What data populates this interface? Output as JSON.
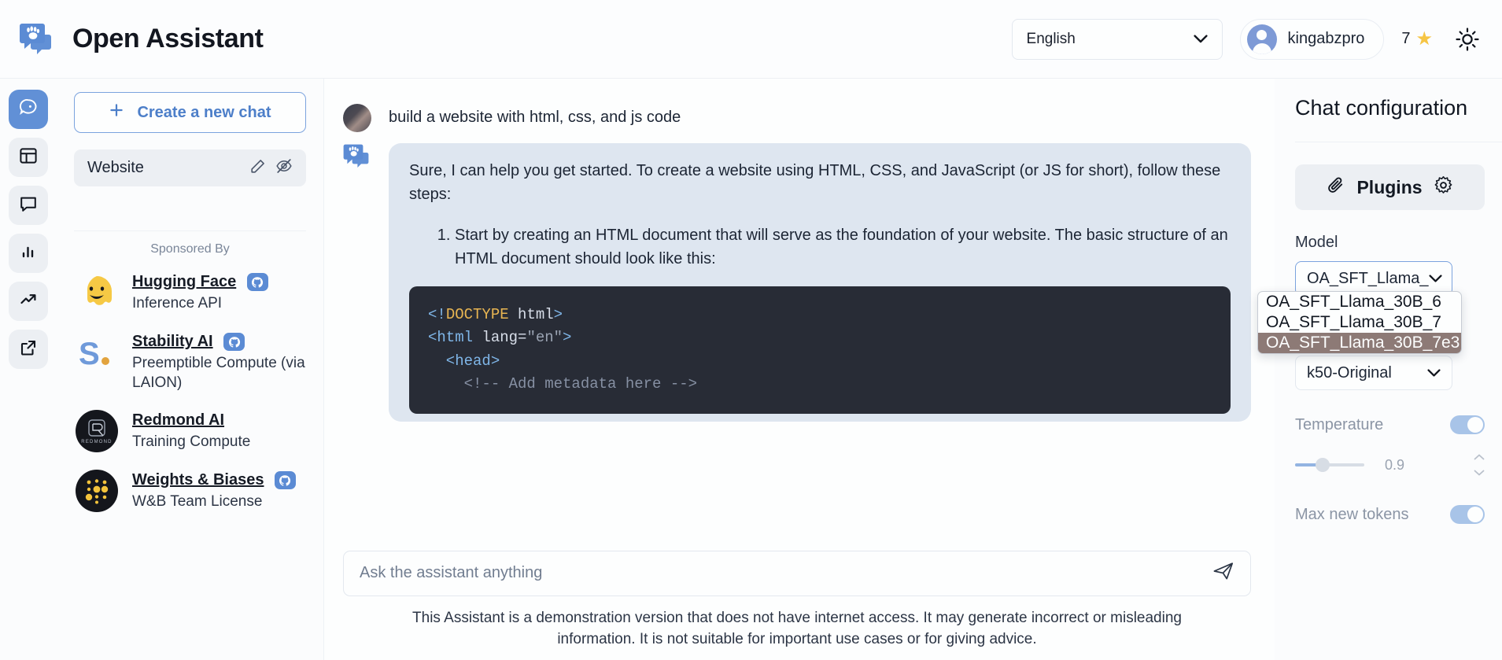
{
  "header": {
    "brand_title": "Open Assistant",
    "brand_logo_icon": "paw-chat-logo-icon",
    "language_value": "English",
    "language_chevron_icon": "chevron-down-icon",
    "user_name": "kingabzpro",
    "avatar_icon": "user-avatar-icon",
    "score_value": "7",
    "star_icon": "star-icon",
    "theme_icon": "sun-icon",
    "accent_color": "#5b8bd4",
    "star_color": "#f6c544"
  },
  "rail": {
    "items": [
      {
        "name": "chat-bubble-dot-icon",
        "label": "Chat",
        "active": true
      },
      {
        "name": "dashboard-layout-icon",
        "label": "Dashboard",
        "active": false
      },
      {
        "name": "message-square-icon",
        "label": "Messages",
        "active": false
      },
      {
        "name": "bar-chart-icon",
        "label": "Leaderboard",
        "active": false
      },
      {
        "name": "trending-up-icon",
        "label": "Stats",
        "active": false
      },
      {
        "name": "external-link-icon",
        "label": "External",
        "active": false
      }
    ]
  },
  "sidebar": {
    "new_chat_label": "Create a new chat",
    "plus_icon": "plus-icon",
    "chats": [
      {
        "title": "Website",
        "edit_icon": "pencil-icon",
        "hide_icon": "eye-off-icon"
      }
    ],
    "sponsored_by_label": "Sponsored By",
    "sponsors": [
      {
        "name": "Hugging Face",
        "subtitle": "Inference API",
        "logo_icon": "hugging-face-logo-icon",
        "github_icon": "github-icon",
        "has_github": true
      },
      {
        "name": "Stability AI",
        "subtitle": "Preemptible Compute (via LAION)",
        "logo_icon": "stability-ai-logo-icon",
        "github_icon": "github-icon",
        "has_github": true
      },
      {
        "name": "Redmond AI",
        "subtitle": "Training Compute",
        "logo_icon": "redmond-ai-logo-icon",
        "github_icon": "github-icon",
        "has_github": false
      },
      {
        "name": "Weights & Biases",
        "subtitle": "W&B Team License",
        "logo_icon": "weights-and-biases-logo-icon",
        "github_icon": "github-icon",
        "has_github": true
      }
    ]
  },
  "chat": {
    "user_message": "build a website with html, css, and js code",
    "assistant_intro": "Sure, I can help you get started. To create a website using HTML, CSS, and JavaScript (or JS for short), follow these steps:",
    "assistant_step_1": "Start by creating an HTML document that will serve as the foundation of your website. The basic structure of an HTML document should look like this:",
    "code_lines": {
      "l1_a": "<!",
      "l1_b": "DOCTYPE",
      "l1_c": " html",
      "l1_d": ">",
      "l2_a": "<html",
      "l2_b": " lang=",
      "l2_c": "\"en\"",
      "l2_d": ">",
      "l3": "  <head>",
      "l4": "    <!-- Add metadata here -->"
    },
    "user_avatar_icon": "user-photo-avatar",
    "bot_avatar_icon": "open-assistant-bot-icon"
  },
  "composer": {
    "placeholder": "Ask the assistant anything",
    "value": "",
    "send_icon": "send-paper-plane-icon",
    "disclaimer": "This Assistant is a demonstration version that does not have internet access. It may generate incorrect or misleading information. It is not suitable for important use cases or for giving advice."
  },
  "config": {
    "title": "Chat configuration",
    "plugins_label": "Plugins",
    "plugins_icon": "paperclip-icon",
    "plugins_settings_icon": "gear-icon",
    "model_label": "Model",
    "model_value": "OA_SFT_Llama_",
    "model_chevron_icon": "chevron-down-icon",
    "dropdown_open": true,
    "dropdown_options": [
      {
        "label": "OA_SFT_Llama_30B_6",
        "selected": false
      },
      {
        "label": "OA_SFT_Llama_30B_7",
        "selected": false
      },
      {
        "label": "OA_SFT_Llama_30B_7e3",
        "selected": true
      }
    ],
    "preset_value": "k50-Original",
    "preset_chevron_icon": "chevron-down-icon",
    "temperature_label": "Temperature",
    "temperature_value": "0.9",
    "temperature_toggle_on": true,
    "max_tokens_label": "Max new tokens",
    "max_tokens_toggle_on": true,
    "stepper_up_icon": "chevron-up-icon",
    "stepper_down_icon": "chevron-down-icon"
  }
}
